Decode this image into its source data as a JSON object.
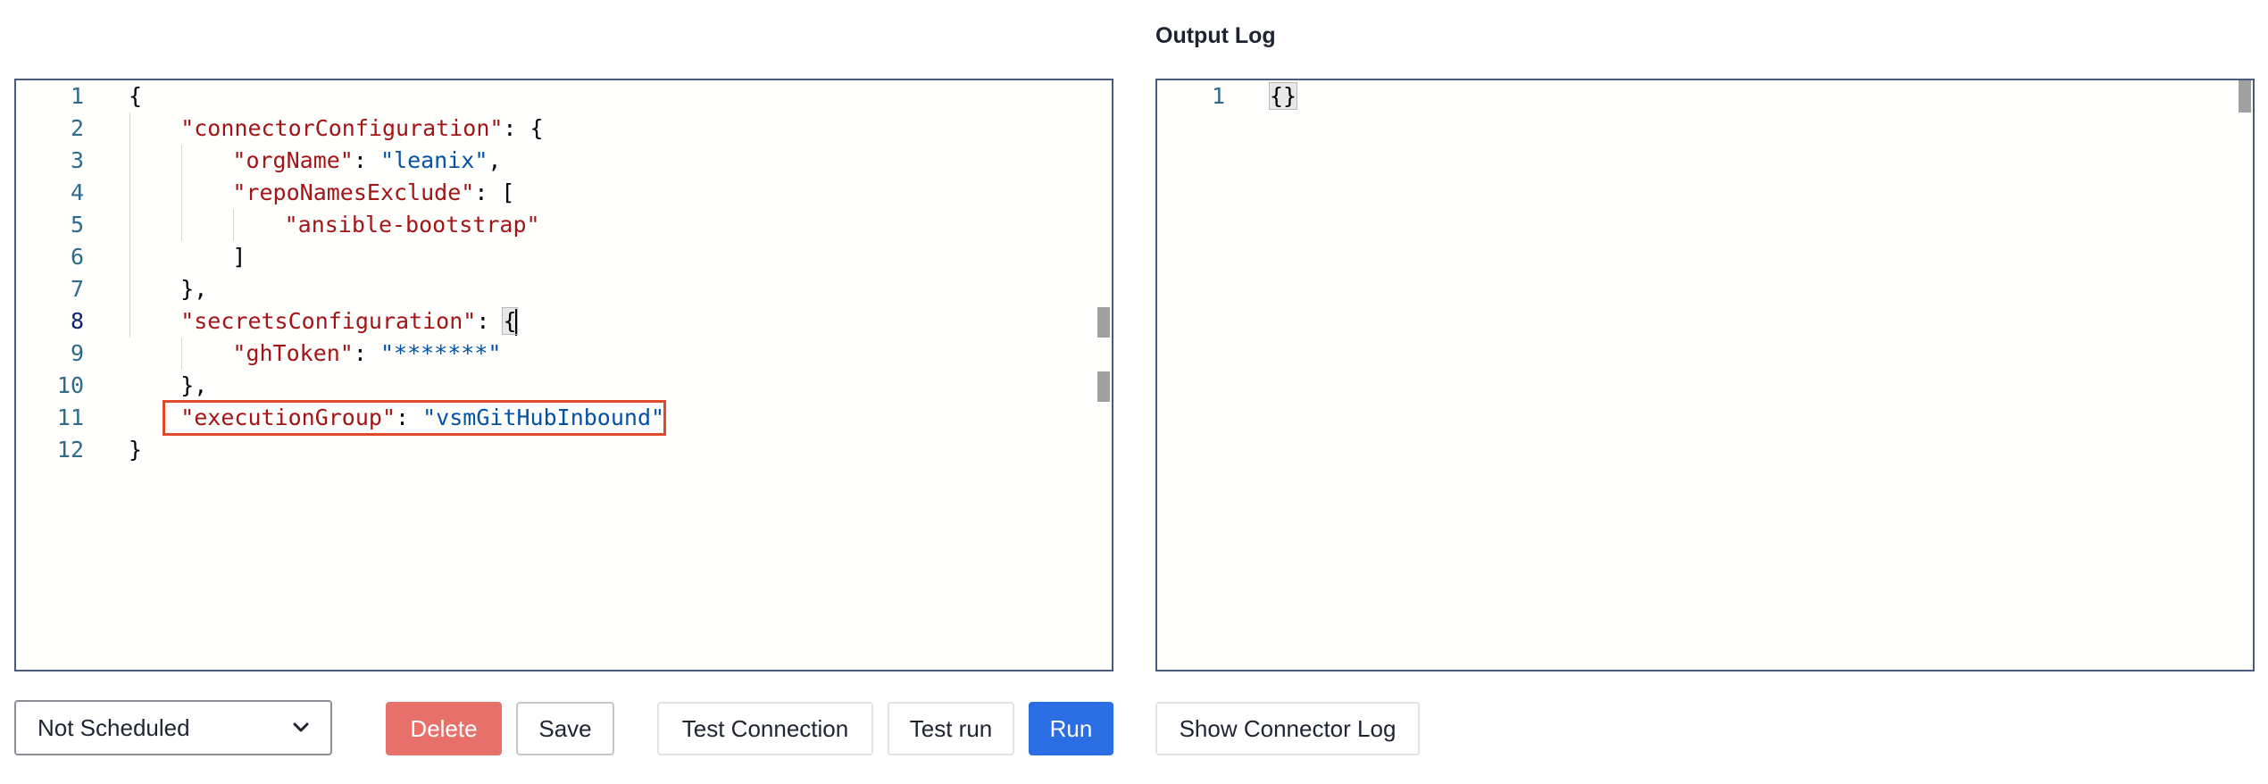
{
  "output_panel": {
    "title": "Output Log"
  },
  "config_editor": {
    "lines": [
      {
        "n": "1",
        "tokens": [
          {
            "t": "p",
            "v": "{"
          }
        ]
      },
      {
        "n": "2",
        "tokens": [
          {
            "t": "k",
            "v": "\"connectorConfiguration\""
          },
          {
            "t": "p",
            "v": ": {"
          }
        ]
      },
      {
        "n": "3",
        "tokens": [
          {
            "t": "k",
            "v": "\"orgName\""
          },
          {
            "t": "p",
            "v": ": "
          },
          {
            "t": "s",
            "v": "\"leanix\""
          },
          {
            "t": "p",
            "v": ","
          }
        ]
      },
      {
        "n": "4",
        "tokens": [
          {
            "t": "k",
            "v": "\"repoNamesExclude\""
          },
          {
            "t": "p",
            "v": ": ["
          }
        ]
      },
      {
        "n": "5",
        "tokens": [
          {
            "t": "k",
            "v": "\"ansible-bootstrap\""
          }
        ]
      },
      {
        "n": "6",
        "tokens": [
          {
            "t": "p",
            "v": "]"
          }
        ]
      },
      {
        "n": "7",
        "tokens": [
          {
            "t": "p",
            "v": "},"
          }
        ]
      },
      {
        "n": "8",
        "tokens": [
          {
            "t": "k",
            "v": "\"secretsConfiguration\""
          },
          {
            "t": "p",
            "v": ": "
          },
          {
            "t": "p",
            "v": "{"
          }
        ]
      },
      {
        "n": "9",
        "tokens": [
          {
            "t": "k",
            "v": "\"ghToken\""
          },
          {
            "t": "p",
            "v": ": "
          },
          {
            "t": "s",
            "v": "\"*******\""
          }
        ]
      },
      {
        "n": "10",
        "tokens": [
          {
            "t": "p",
            "v": "},"
          }
        ]
      },
      {
        "n": "11",
        "tokens": [
          {
            "t": "k",
            "v": "\"executionGroup\""
          },
          {
            "t": "p",
            "v": ": "
          },
          {
            "t": "s",
            "v": "\"vsmGitHubInbound\""
          }
        ]
      },
      {
        "n": "12",
        "tokens": [
          {
            "t": "p",
            "v": "}"
          }
        ]
      }
    ]
  },
  "output_editor": {
    "lines": [
      {
        "n": "1",
        "tokens": [
          {
            "t": "p",
            "v": "{}"
          }
        ]
      }
    ]
  },
  "toolbar": {
    "schedule_select": "Not Scheduled",
    "delete_label": "Delete",
    "save_label": "Save",
    "test_connection_label": "Test Connection",
    "test_run_label": "Test run",
    "run_label": "Run",
    "show_log_label": "Show Connector Log"
  },
  "colors": {
    "key": "#a31515",
    "string": "#0451a5",
    "delete": "#e8706a",
    "run": "#2b6de3",
    "highlight": "#e04a2a"
  },
  "icons": {
    "schedule_dropdown": "chevron-down-icon"
  }
}
